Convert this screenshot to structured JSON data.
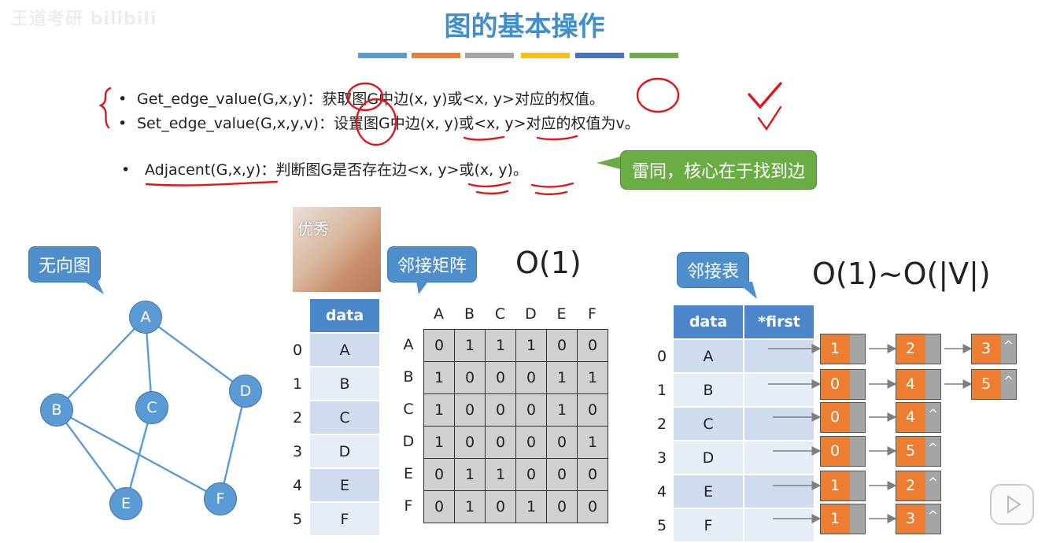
{
  "watermark": "王道考研 bilibili",
  "title": "图的基本操作",
  "accent_colors": [
    "#5b9bd5",
    "#ed7d31",
    "#a5a5a5",
    "#ffc000",
    "#4472c4",
    "#70ad47"
  ],
  "bullets": [
    {
      "name": "Get_edge_value(G,x,y)：",
      "desc": "获取图G中边(x, y)或<x, y>对应的权值。"
    },
    {
      "name": "Set_edge_value(G,x,y,v)：",
      "desc": "设置图G中边(x, y)或<x, y>对应的权值为v。"
    },
    {
      "name": "Adjacent(G,x,y)：",
      "desc": "判断图G是否存在边<x, y>或(x, y)。"
    }
  ],
  "green_note": "雷同，核心在于找到边",
  "thumb_caption": "优秀",
  "callouts": {
    "graph": "无向图",
    "matrix": "邻接矩阵",
    "list": "邻接表"
  },
  "complexity": {
    "matrix": "O(1)",
    "list": "O(1)~O(|V|)"
  },
  "graph_nodes": [
    "A",
    "B",
    "C",
    "D",
    "E",
    "F"
  ],
  "data_table": {
    "header": "data",
    "indices": [
      "0",
      "1",
      "2",
      "3",
      "4",
      "5"
    ],
    "values": [
      "A",
      "B",
      "C",
      "D",
      "E",
      "F"
    ]
  },
  "matrix": {
    "cols": [
      "A",
      "B",
      "C",
      "D",
      "E",
      "F"
    ],
    "rows": [
      "A",
      "B",
      "C",
      "D",
      "E",
      "F"
    ],
    "values": [
      [
        "0",
        "1",
        "1",
        "1",
        "0",
        "0"
      ],
      [
        "1",
        "0",
        "0",
        "0",
        "1",
        "1"
      ],
      [
        "1",
        "0",
        "0",
        "0",
        "1",
        "0"
      ],
      [
        "1",
        "0",
        "0",
        "0",
        "0",
        "1"
      ],
      [
        "0",
        "1",
        "1",
        "0",
        "0",
        "0"
      ],
      [
        "0",
        "1",
        "0",
        "1",
        "0",
        "0"
      ]
    ]
  },
  "adj_list": {
    "header_data": "data",
    "header_first": "*first",
    "indices": [
      "0",
      "1",
      "2",
      "3",
      "4",
      "5"
    ],
    "vertices": [
      "A",
      "B",
      "C",
      "D",
      "E",
      "F"
    ],
    "chains": [
      [
        "1",
        "2",
        "3"
      ],
      [
        "0",
        "4",
        "5"
      ],
      [
        "0",
        "4"
      ],
      [
        "0",
        "5"
      ],
      [
        "1",
        "2"
      ],
      [
        "1",
        "3"
      ]
    ],
    "null_mark": "^"
  }
}
